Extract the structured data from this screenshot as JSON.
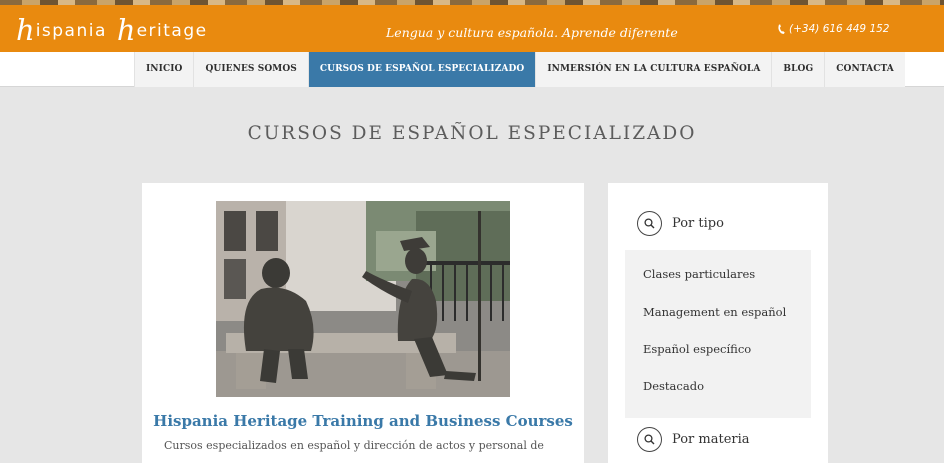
{
  "header": {
    "logo_initial_1": "h",
    "logo_rest_1": "ispania",
    "logo_initial_2": "h",
    "logo_rest_2": "eritage",
    "tagline": "Lengua y cultura española. Aprende diferente",
    "phone": "(+34) 616 449 152",
    "phone_icon": "phone-icon",
    "color": "#e98a0f"
  },
  "nav": {
    "items": [
      {
        "label": "INICIO"
      },
      {
        "label": "QUIENES SOMOS"
      },
      {
        "label": "CURSOS DE ESPAÑOL ESPECIALIZADO",
        "active": true
      },
      {
        "label": "INMERSIÓN EN LA CULTURA ESPAÑOLA"
      },
      {
        "label": "BLOG"
      },
      {
        "label": "CONTACTA"
      }
    ],
    "active_color": "#3a79a8"
  },
  "page": {
    "title": "CURSOS DE ESPAÑOL ESPECIALIZADO"
  },
  "post": {
    "image": "bronze statues of two seated figures on a stone bench",
    "title": "Hispania Heritage Training and Business Courses",
    "excerpt": "Cursos especializados en español y dirección de actos y personal de"
  },
  "sidebar": {
    "widget1": {
      "icon": "search-icon",
      "title": "Por tipo",
      "items": [
        {
          "label": "Clases particulares"
        },
        {
          "label": "Management en español"
        },
        {
          "label": "Español específico"
        },
        {
          "label": "Destacado"
        }
      ]
    },
    "widget2": {
      "icon": "search-icon",
      "title": "Por materia"
    }
  }
}
